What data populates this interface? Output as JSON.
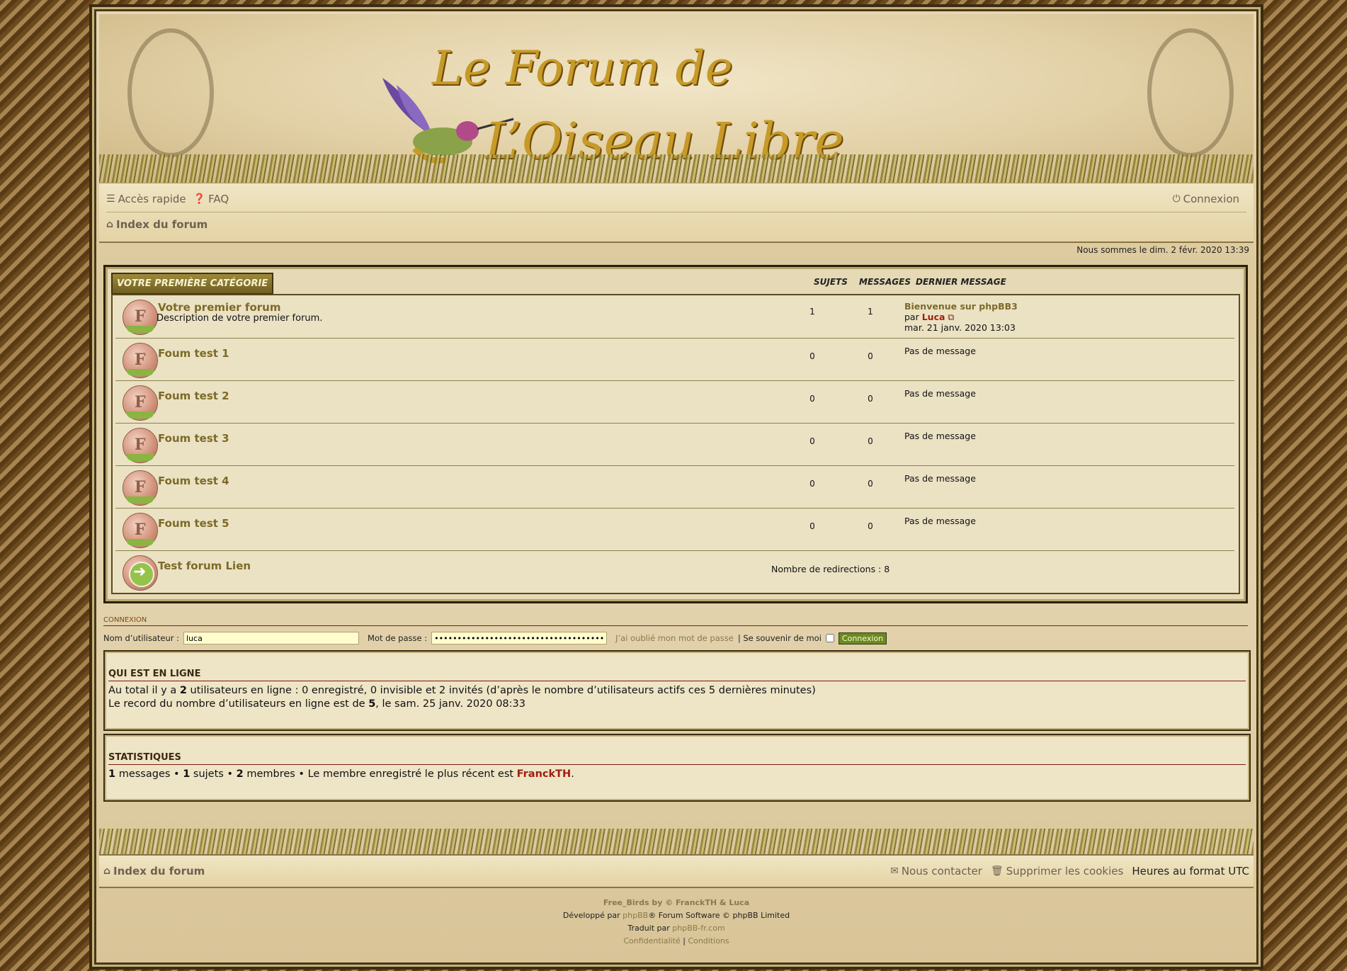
{
  "header": {
    "logo_line1": "Le Forum de",
    "logo_line2": "L’Oiseau Libre"
  },
  "nav": {
    "quick_access": "Accès rapide",
    "faq": "FAQ",
    "login": "Connexion",
    "index": "Index du forum"
  },
  "date_text": "Nous sommes le dim. 2 févr. 2020 13:39",
  "category": {
    "title": "VOTRE PREMIÈRE CATÉGORIE",
    "col_topics": "SUJETS",
    "col_posts": "MESSAGES",
    "col_last": "DERNIER MESSAGE"
  },
  "forums": [
    {
      "name": "Votre premier forum",
      "desc": "Description de votre premier forum.",
      "topics": "1",
      "posts": "1",
      "last_title": "Bienvenue sur phpBB3",
      "last_by": "par",
      "last_user": "Luca",
      "last_date": "mar. 21 janv. 2020 13:03"
    },
    {
      "name": "Foum test 1",
      "topics": "0",
      "posts": "0",
      "last": "Pas de message"
    },
    {
      "name": "Foum test 2",
      "topics": "0",
      "posts": "0",
      "last": "Pas de message"
    },
    {
      "name": "Foum test 3",
      "topics": "0",
      "posts": "0",
      "last": "Pas de message"
    },
    {
      "name": "Foum test 4",
      "topics": "0",
      "posts": "0",
      "last": "Pas de message"
    },
    {
      "name": "Foum test 5",
      "topics": "0",
      "posts": "0",
      "last": "Pas de message"
    },
    {
      "name": "Test forum Lien",
      "redirects": "Nombre de redirections : 8"
    }
  ],
  "login": {
    "title": "CONNEXION",
    "username_label": "Nom d’utilisateur :",
    "username_value": "luca",
    "password_label": "Mot de passe :",
    "password_value": "••••••••••••••••••••••••••••••••••••••",
    "forgot": "J’ai oublié mon mot de passe",
    "remember": "| Se souvenir de moi",
    "button": "Connexion"
  },
  "online": {
    "title": "QUI EST EN LIGNE",
    "line1_a": "Au total il y a ",
    "line1_count": "2",
    "line1_b": " utilisateurs en ligne : 0 enregistré, 0 invisible et 2 invités (d’après le nombre d’utilisateurs actifs ces 5 dernières minutes)",
    "line2_a": "Le record du nombre d’utilisateurs en ligne est de ",
    "line2_count": "5",
    "line2_b": ", le sam. 25 janv. 2020 08:33"
  },
  "stats": {
    "title": "STATISTIQUES",
    "messages_count": "1",
    "messages_label": " messages • ",
    "topics_count": "1",
    "topics_label": " sujets • ",
    "members_count": "2",
    "members_label": " membres • Le membre enregistré le plus récent est ",
    "newest": "FranckTH",
    "end": "."
  },
  "footer": {
    "index": "Index du forum",
    "contact": "Nous contacter",
    "cookies": "Supprimer les cookies",
    "timezone": "Heures au format UTC",
    "credit1": "Free_Birds by © FranckTH & Luca",
    "credit2_a": "Développé par ",
    "credit2_link": "phpBB",
    "credit2_b": "® Forum Software © phpBB Limited",
    "credit3_a": "Traduit par ",
    "credit3_link": "phpBB-fr.com",
    "privacy": "Confidentialité",
    "sep": "|",
    "terms": "Conditions"
  },
  "icons": {
    "menu": "menu-icon",
    "faq": "question-icon",
    "power": "power-icon",
    "home": "home-icon",
    "mail": "mail-icon",
    "trash": "trash-icon",
    "forum": "forum-read-icon",
    "link": "forum-link-icon",
    "view": "view-latest-post-icon"
  }
}
